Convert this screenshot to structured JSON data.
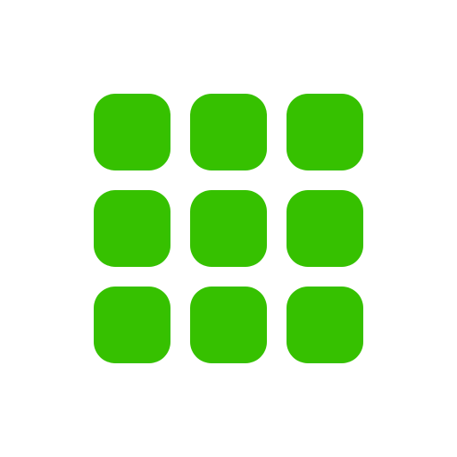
{
  "icon": {
    "name": "app-grid-icon",
    "rows": 3,
    "columns": 3
  },
  "colors": {
    "tile": "#36c100",
    "background": "#ffffff"
  }
}
